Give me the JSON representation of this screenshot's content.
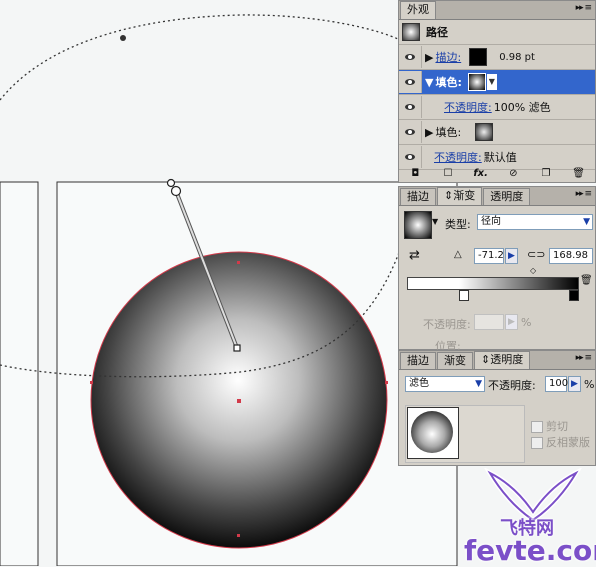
{
  "appearance_panel": {
    "tab_label": "外观",
    "menu_glyph": "▸▸ ≡",
    "item_title": "路径",
    "rows": [
      {
        "label": "描边:",
        "value": "0.98 pt"
      },
      {
        "label": "填色:"
      },
      {
        "label": "不透明度:",
        "value": "100% 滤色"
      },
      {
        "label": "填色:"
      },
      {
        "label": "不透明度:",
        "value": "默认值"
      }
    ],
    "footer_icons": [
      "new-art-icon",
      "clear-icon",
      "fx-icon",
      "no-icon",
      "duplicate-icon",
      "trash-icon"
    ],
    "fx_label": "fx."
  },
  "gradient_panel": {
    "tabs": [
      "描边",
      "渐变",
      "透明度"
    ],
    "active_tab": "渐变",
    "type_label": "类型:",
    "type_value": "径向",
    "angle_value": "-71.2",
    "ratio_value": "168.98",
    "opacity_label": "不透明度:",
    "location_label": "位置:",
    "percent": "%"
  },
  "transparency_panel": {
    "tabs": [
      "描边",
      "渐变",
      "透明度"
    ],
    "active_tab": "透明度",
    "blend_mode": "滤色",
    "opacity_label": "不透明度:",
    "opacity_value": "100",
    "percent": "%",
    "clip_label": "剪切",
    "invert_label": "反相蒙版"
  },
  "watermark": {
    "cn_text": "飞特网",
    "url_text": "fevte.com"
  },
  "colors": {
    "selection": "#3366cc",
    "path_stroke": "#d23a4a",
    "panel_bg": "#d4d0c8",
    "watermark_purple": "#7b4fc8"
  }
}
